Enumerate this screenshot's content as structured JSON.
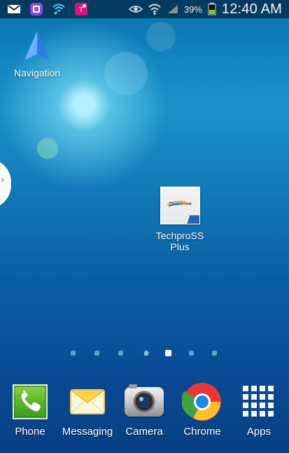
{
  "status_bar": {
    "left_icons": [
      "gmail-icon",
      "voice-app-icon",
      "wifi-call-icon",
      "tmobile-icon"
    ],
    "right_icons": [
      "eye-icon",
      "wifi-signal-icon",
      "cell-signal-icon",
      "battery-icon"
    ],
    "battery_percent": "39%",
    "time": "12:40 AM"
  },
  "home": {
    "shortcuts": [
      {
        "label": "Navigation",
        "icon": "navigation-arrow-icon"
      },
      {
        "label_line1": "TechproSS",
        "label_line2": "Plus",
        "icon": "techpross-plus-icon"
      }
    ],
    "page_indicator": {
      "current": 5,
      "total": 7
    }
  },
  "dock": {
    "items": [
      {
        "label": "Phone",
        "icon": "phone-icon"
      },
      {
        "label": "Messaging",
        "icon": "messaging-icon"
      },
      {
        "label": "Camera",
        "icon": "camera-icon"
      },
      {
        "label": "Chrome",
        "icon": "chrome-icon"
      },
      {
        "label": "Apps",
        "icon": "apps-grid-icon"
      }
    ]
  },
  "colors": {
    "wallpaper_top": "#0d6fa6",
    "wallpaper_mid": "#1a92c7",
    "wallpaper_bottom": "#083f83",
    "accent": "#5fb52b"
  }
}
